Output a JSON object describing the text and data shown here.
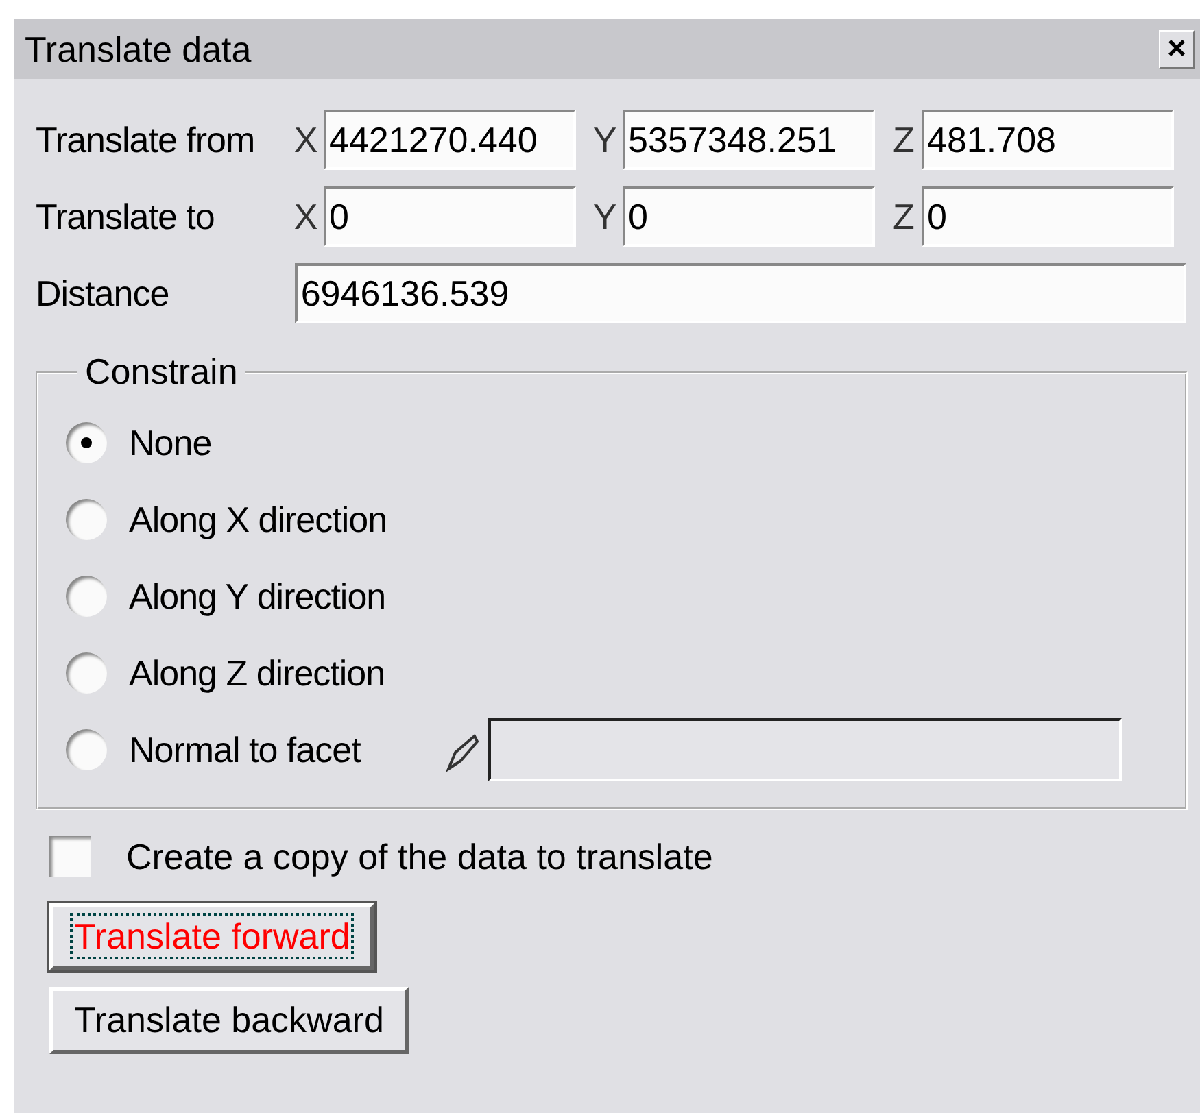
{
  "window": {
    "title": "Translate data",
    "close": "×"
  },
  "coordinates": [
    {
      "label": "Translate from",
      "fields": [
        {
          "axis": "X",
          "value": "4421270.440"
        },
        {
          "axis": "Y",
          "value": "5357348.251"
        },
        {
          "axis": "Z",
          "value": "481.708"
        }
      ]
    },
    {
      "label": "Translate to",
      "fields": [
        {
          "axis": "X",
          "value": "0"
        },
        {
          "axis": "Y",
          "value": "0"
        },
        {
          "axis": "Z",
          "value": "0"
        }
      ]
    }
  ],
  "distance": {
    "label": "Distance",
    "value": "6946136.539"
  },
  "constrain": {
    "title": "Constrain",
    "options": [
      {
        "label": "None",
        "selected": true
      },
      {
        "label": "Along X direction",
        "selected": false
      },
      {
        "label": "Along Y direction",
        "selected": false
      },
      {
        "label": "Along Z direction",
        "selected": false
      },
      {
        "label": "Normal to facet",
        "selected": false,
        "kind": "facet",
        "disabled": true
      }
    ]
  },
  "copy": {
    "label": "Create a copy of the data to translate",
    "checked": false
  },
  "buttons": [
    {
      "label": "Translate forward",
      "focused": true
    },
    {
      "label": "Translate backward",
      "focused": false
    }
  ]
}
